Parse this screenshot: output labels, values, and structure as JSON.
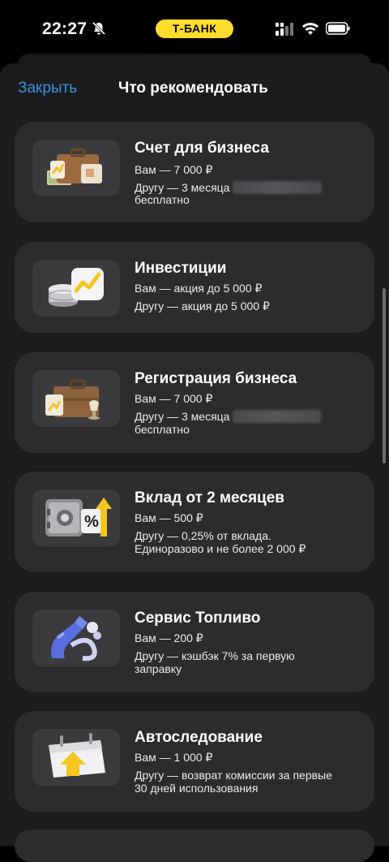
{
  "status_bar": {
    "time": "22:27",
    "bank_badge": "Т-БАНК",
    "icons": [
      "bell-muted-icon",
      "signal-icon",
      "wifi-icon",
      "battery-icon"
    ]
  },
  "header": {
    "close_label": "Закрыть",
    "title": "Что рекомендовать"
  },
  "colors": {
    "accent_link": "#3D8FE0",
    "badge_yellow": "#FFDD2D",
    "card_bg": "#2C2C2E",
    "sheet_bg": "#1C1C1E"
  },
  "cards": [
    {
      "title": "Счет для бизнеса",
      "you": "Вам — 7 000 ₽",
      "friend_1": "Другу — 3 месяца",
      "friend_2": "бесплатно",
      "icon": "briefcase-documents-icon"
    },
    {
      "title": "Инвестиции",
      "you": "Вам — акция до 5 000 ₽",
      "friend_1": "Другу — акция до 5 000 ₽",
      "icon": "coins-chart-icon"
    },
    {
      "title": "Регистрация бизнеса",
      "you": "Вам — 7 000 ₽",
      "friend_1": "Другу — 3 месяца",
      "friend_2": "бесплатно",
      "icon": "briefcase-registration-icon"
    },
    {
      "title": "Вклад от 2 месяцев",
      "you": "Вам — 500 ₽",
      "friend_1": "Другу — 0,25% от вклада.",
      "friend_2": "Единоразово и не более 2 000 ₽",
      "icon": "safe-percent-icon"
    },
    {
      "title": "Сервис Топливо",
      "you": "Вам — 200 ₽",
      "friend_1": "Другу — кэшбэк 7% за первую",
      "friend_2": "заправку",
      "icon": "fuel-nozzle-icon"
    },
    {
      "title": "Автоследование",
      "you": "Вам — 1 000 ₽",
      "friend_1": "Другу — возврат комиссии за первые",
      "friend_2": "30 дней использования",
      "icon": "calendar-arrow-icon"
    }
  ]
}
